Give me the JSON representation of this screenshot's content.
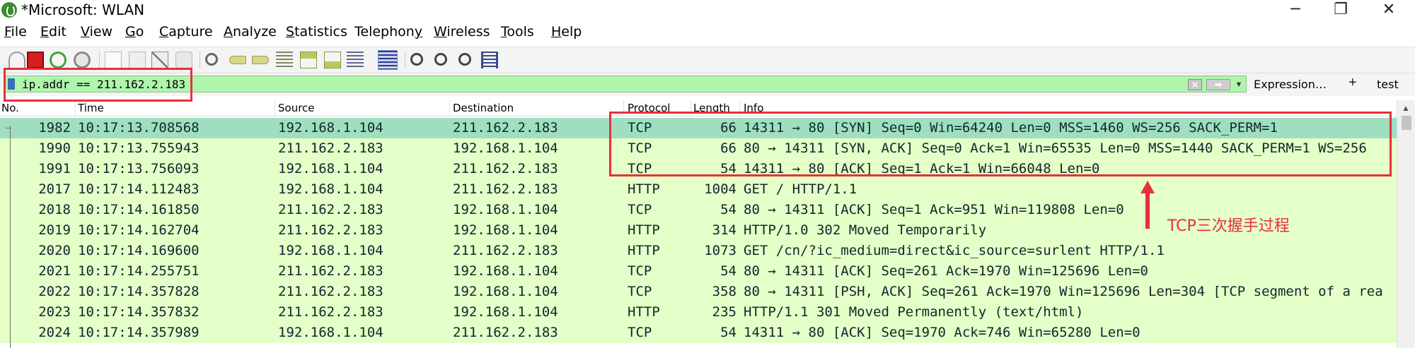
{
  "window": {
    "title": "*Microsoft: WLAN",
    "controls": {
      "minimize": "─",
      "maximize": "❐",
      "close": "✕"
    }
  },
  "menu": [
    {
      "pre": "",
      "acc": "F",
      "post": "ile"
    },
    {
      "pre": "",
      "acc": "E",
      "post": "dit"
    },
    {
      "pre": "",
      "acc": "V",
      "post": "iew"
    },
    {
      "pre": "",
      "acc": "G",
      "post": "o"
    },
    {
      "pre": "",
      "acc": "C",
      "post": "apture"
    },
    {
      "pre": "",
      "acc": "A",
      "post": "nalyze"
    },
    {
      "pre": "",
      "acc": "S",
      "post": "tatistics"
    },
    {
      "pre": "Telephon",
      "acc": "y",
      "post": ""
    },
    {
      "pre": "",
      "acc": "W",
      "post": "ireless"
    },
    {
      "pre": "",
      "acc": "T",
      "post": "ools"
    },
    {
      "pre": "",
      "acc": "H",
      "post": "elp"
    }
  ],
  "toolbar": {
    "icons": [
      "start-capture-icon",
      "stop-capture-icon",
      "restart-capture-icon",
      "capture-options-icon",
      "open-file-icon",
      "save-file-icon",
      "close-file-icon",
      "reload-file-icon",
      "find-packet-icon",
      "go-back-icon",
      "go-forward-icon",
      "go-to-packet-icon",
      "first-packet-icon",
      "last-packet-icon",
      "auto-scroll-icon",
      "colorize-icon",
      "zoom-in-icon",
      "zoom-out-icon",
      "zoom-normal-icon",
      "resize-columns-icon"
    ]
  },
  "filter": {
    "value": "ip.addr == 211.162.2.183",
    "clear_label": "✕",
    "apply_label": "➡",
    "recent_label": "▼",
    "expression_label": "Expression…",
    "add_label": "+",
    "test_label": "test"
  },
  "columns": {
    "no": "No.",
    "time": "Time",
    "source": "Source",
    "destination": "Destination",
    "protocol": "Protocol",
    "length": "Length",
    "info": "Info"
  },
  "packets": [
    {
      "no": "1982",
      "time": "10:17:13.708568",
      "source": "192.168.1.104",
      "destination": "211.162.2.183",
      "protocol": "TCP",
      "length": "66",
      "info": "14311 → 80 [SYN] Seq=0 Win=64240 Len=0 MSS=1460 WS=256 SACK_PERM=1",
      "selected": true
    },
    {
      "no": "1990",
      "time": "10:17:13.755943",
      "source": "211.162.2.183",
      "destination": "192.168.1.104",
      "protocol": "TCP",
      "length": "66",
      "info": "80 → 14311 [SYN, ACK] Seq=0 Ack=1 Win=65535 Len=0 MSS=1440 SACK_PERM=1 WS=256",
      "selected": false
    },
    {
      "no": "1991",
      "time": "10:17:13.756093",
      "source": "192.168.1.104",
      "destination": "211.162.2.183",
      "protocol": "TCP",
      "length": "54",
      "info": "14311 → 80 [ACK] Seq=1 Ack=1 Win=66048 Len=0",
      "selected": false
    },
    {
      "no": "2017",
      "time": "10:17:14.112483",
      "source": "192.168.1.104",
      "destination": "211.162.2.183",
      "protocol": "HTTP",
      "length": "1004",
      "info": "GET / HTTP/1.1",
      "selected": false
    },
    {
      "no": "2018",
      "time": "10:17:14.161850",
      "source": "211.162.2.183",
      "destination": "192.168.1.104",
      "protocol": "TCP",
      "length": "54",
      "info": "80 → 14311 [ACK] Seq=1 Ack=951 Win=119808 Len=0",
      "selected": false
    },
    {
      "no": "2019",
      "time": "10:17:14.162704",
      "source": "211.162.2.183",
      "destination": "192.168.1.104",
      "protocol": "HTTP",
      "length": "314",
      "info": "HTTP/1.0 302 Moved Temporarily",
      "selected": false
    },
    {
      "no": "2020",
      "time": "10:17:14.169600",
      "source": "192.168.1.104",
      "destination": "211.162.2.183",
      "protocol": "HTTP",
      "length": "1073",
      "info": "GET /cn/?ic_medium=direct&ic_source=surlent HTTP/1.1",
      "selected": false
    },
    {
      "no": "2021",
      "time": "10:17:14.255751",
      "source": "211.162.2.183",
      "destination": "192.168.1.104",
      "protocol": "TCP",
      "length": "54",
      "info": "80 → 14311 [ACK] Seq=261 Ack=1970 Win=125696 Len=0",
      "selected": false
    },
    {
      "no": "2022",
      "time": "10:17:14.357828",
      "source": "211.162.2.183",
      "destination": "192.168.1.104",
      "protocol": "TCP",
      "length": "358",
      "info": "80 → 14311 [PSH, ACK] Seq=261 Ack=1970 Win=125696 Len=304 [TCP segment of a rea",
      "selected": false
    },
    {
      "no": "2023",
      "time": "10:17:14.357832",
      "source": "211.162.2.183",
      "destination": "192.168.1.104",
      "protocol": "HTTP",
      "length": "235",
      "info": "HTTP/1.1 301 Moved Permanently  (text/html)",
      "selected": false
    },
    {
      "no": "2024",
      "time": "10:17:14.357989",
      "source": "192.168.1.104",
      "destination": "211.162.2.183",
      "protocol": "TCP",
      "length": "54",
      "info": "14311 → 80 [ACK] Seq=1970 Ack=746 Win=65280 Len=0",
      "selected": false
    }
  ],
  "annotation": {
    "text": "TCP三次握手过程",
    "color": "#e8303a"
  },
  "colors": {
    "filter_valid": "#aff5ac",
    "row_tcp_http": "#e4ffc7",
    "row_selected": "#9fdfc0"
  }
}
